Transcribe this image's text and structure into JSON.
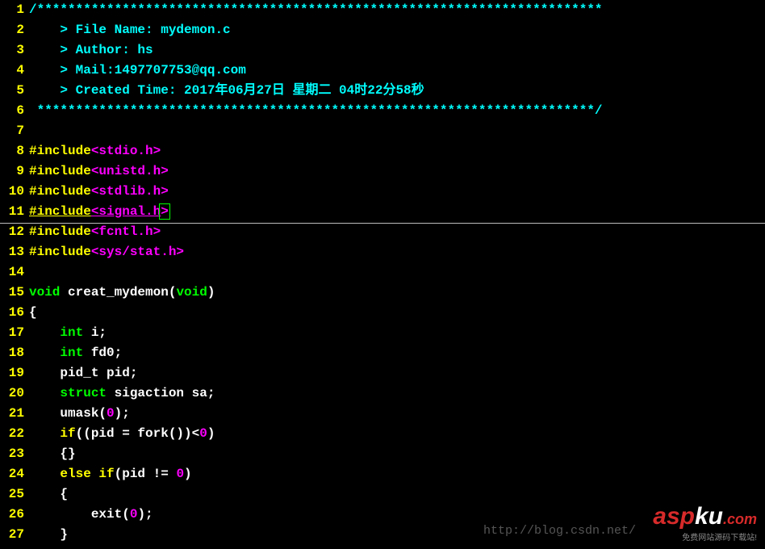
{
  "editor": {
    "lines": [
      {
        "n": "1",
        "segments": [
          {
            "cls": "cyan",
            "t": "/*************************************************************************"
          }
        ]
      },
      {
        "n": "2",
        "segments": [
          {
            "cls": "cyan",
            "t": "    > File Name: mydemon.c"
          }
        ]
      },
      {
        "n": "3",
        "segments": [
          {
            "cls": "cyan",
            "t": "    > Author: hs"
          }
        ]
      },
      {
        "n": "4",
        "segments": [
          {
            "cls": "cyan",
            "t": "    > Mail:1497707753@qq.com "
          }
        ]
      },
      {
        "n": "5",
        "segments": [
          {
            "cls": "cyan",
            "t": "    > Created Time: 2017年06月27日 星期二 04时22分58秒"
          }
        ]
      },
      {
        "n": "6",
        "segments": [
          {
            "cls": "cyan",
            "t": " ************************************************************************/"
          }
        ]
      },
      {
        "n": "7",
        "segments": []
      },
      {
        "n": "8",
        "segments": [
          {
            "cls": "yellow",
            "t": "#include"
          },
          {
            "cls": "magenta",
            "t": "<stdio.h>"
          }
        ]
      },
      {
        "n": "9",
        "segments": [
          {
            "cls": "yellow",
            "t": "#include"
          },
          {
            "cls": "magenta",
            "t": "<unistd.h>"
          }
        ]
      },
      {
        "n": "10",
        "segments": [
          {
            "cls": "yellow",
            "t": "#include"
          },
          {
            "cls": "magenta",
            "t": "<stdlib.h>"
          }
        ]
      },
      {
        "n": "11",
        "cursor": true,
        "segments": [
          {
            "cls": "yellow cursorline",
            "t": "#include"
          },
          {
            "cls": "magenta cursorline",
            "t": "<signal.h"
          },
          {
            "cls": "magenta cursorbox",
            "t": ">"
          }
        ]
      },
      {
        "n": "12",
        "segments": [
          {
            "cls": "yellow",
            "t": "#include"
          },
          {
            "cls": "magenta",
            "t": "<fcntl.h>"
          }
        ]
      },
      {
        "n": "13",
        "segments": [
          {
            "cls": "yellow",
            "t": "#include"
          },
          {
            "cls": "magenta",
            "t": "<sys/stat.h>"
          }
        ]
      },
      {
        "n": "14",
        "segments": []
      },
      {
        "n": "15",
        "segments": [
          {
            "cls": "green",
            "t": "void"
          },
          {
            "cls": "white",
            "t": " creat_mydemon("
          },
          {
            "cls": "green",
            "t": "void"
          },
          {
            "cls": "white",
            "t": ")"
          }
        ]
      },
      {
        "n": "16",
        "segments": [
          {
            "cls": "white",
            "t": "{"
          }
        ]
      },
      {
        "n": "17",
        "segments": [
          {
            "cls": "white",
            "t": "    "
          },
          {
            "cls": "green",
            "t": "int"
          },
          {
            "cls": "white",
            "t": " i;"
          }
        ]
      },
      {
        "n": "18",
        "segments": [
          {
            "cls": "white",
            "t": "    "
          },
          {
            "cls": "green",
            "t": "int"
          },
          {
            "cls": "white",
            "t": " fd0;"
          }
        ]
      },
      {
        "n": "19",
        "segments": [
          {
            "cls": "white",
            "t": "    pid_t pid;"
          }
        ]
      },
      {
        "n": "20",
        "segments": [
          {
            "cls": "white",
            "t": "    "
          },
          {
            "cls": "green",
            "t": "struct"
          },
          {
            "cls": "white",
            "t": " sigaction sa;"
          }
        ]
      },
      {
        "n": "21",
        "segments": [
          {
            "cls": "white",
            "t": "    umask("
          },
          {
            "cls": "magenta",
            "t": "0"
          },
          {
            "cls": "white",
            "t": ");"
          }
        ]
      },
      {
        "n": "22",
        "segments": [
          {
            "cls": "white",
            "t": "    "
          },
          {
            "cls": "yellow",
            "t": "if"
          },
          {
            "cls": "white",
            "t": "((pid = fork())<"
          },
          {
            "cls": "magenta",
            "t": "0"
          },
          {
            "cls": "white",
            "t": ")"
          }
        ]
      },
      {
        "n": "23",
        "segments": [
          {
            "cls": "white",
            "t": "    {}"
          }
        ]
      },
      {
        "n": "24",
        "segments": [
          {
            "cls": "white",
            "t": "    "
          },
          {
            "cls": "yellow",
            "t": "else"
          },
          {
            "cls": "white",
            "t": " "
          },
          {
            "cls": "yellow",
            "t": "if"
          },
          {
            "cls": "white",
            "t": "(pid != "
          },
          {
            "cls": "magenta",
            "t": "0"
          },
          {
            "cls": "white",
            "t": ")"
          }
        ]
      },
      {
        "n": "25",
        "segments": [
          {
            "cls": "white",
            "t": "    {"
          }
        ]
      },
      {
        "n": "26",
        "segments": [
          {
            "cls": "white",
            "t": "        exit("
          },
          {
            "cls": "magenta",
            "t": "0"
          },
          {
            "cls": "white",
            "t": ");"
          }
        ]
      },
      {
        "n": "27",
        "segments": [
          {
            "cls": "white",
            "t": "    }"
          }
        ]
      }
    ]
  },
  "watermark": {
    "brand_a": "asp",
    "brand_b": "ku",
    "tld": ".com",
    "tagline": "免费网站源码下载站!"
  },
  "bloglink": "http://blog.csdn.net/"
}
